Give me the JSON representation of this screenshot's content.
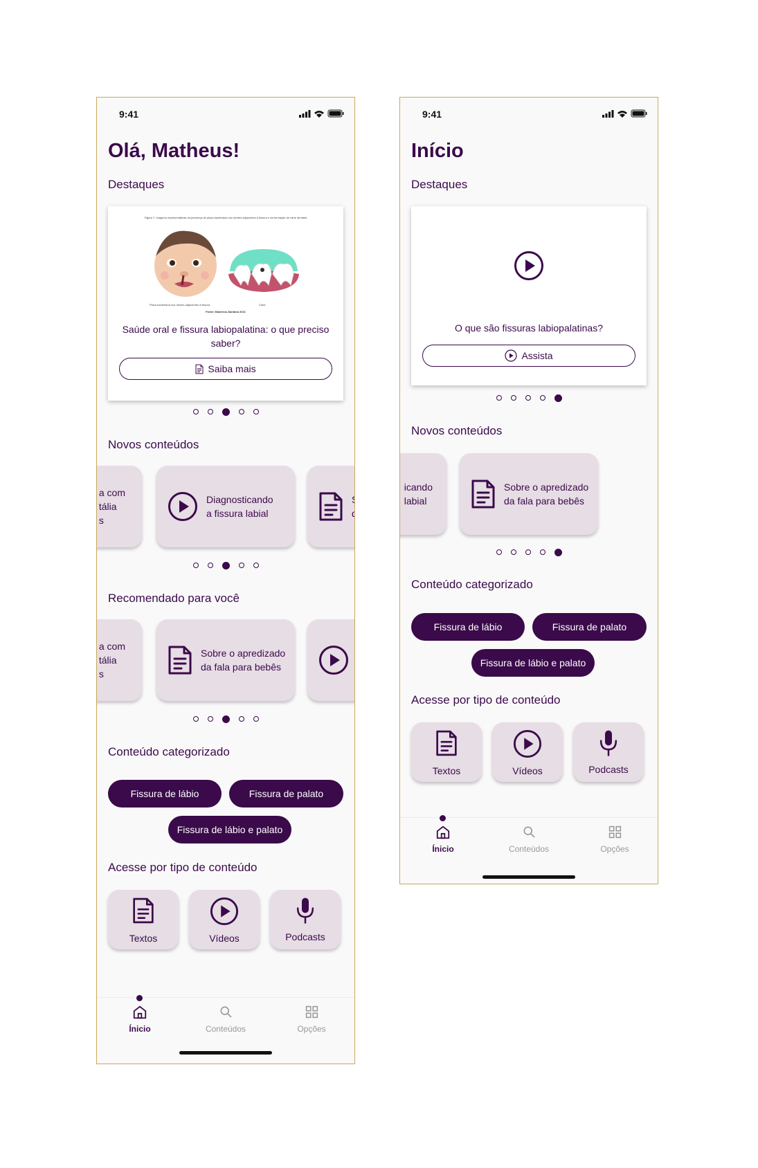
{
  "colors": {
    "primary": "#3a0a4a",
    "card_bg": "#e7dde5",
    "screen_bg": "#faf9fa",
    "frame_border": "#c9a85a"
  },
  "screen1": {
    "status_time": "9:41",
    "greeting": "Olá, Matheus!",
    "highlights": {
      "title": "Destaques",
      "figure_caption": "Figura 7: Imagens representativas da presença de placa bacteriana nos dentes adjacentes à fissura e da formação de cárie dentária",
      "figure_label_left": "Placa bacteriana nos dentes adjacentes à fissura",
      "figure_label_right": "Cárie",
      "figure_source": "Fonte: Madeiros-Santana 2021",
      "card_text": "Saúde oral e fissura labiopalatina: o que preciso saber?",
      "button_label": "Saiba mais",
      "dots_total": 5,
      "dots_active": 3
    },
    "new_content": {
      "title": "Novos conteúdos",
      "cards": [
        {
          "line1": "a com",
          "line2": "tália",
          "line3": "s",
          "icon": "partial-card"
        },
        {
          "line1": "Diagnosticando",
          "line2": "a fissura labial",
          "icon": "play-circle-icon"
        },
        {
          "line1": "S",
          "line2": "d",
          "icon": "document-icon"
        }
      ],
      "dots_active": 3
    },
    "recommended": {
      "title": "Recomendado para você",
      "cards": [
        {
          "line1": "a com",
          "line2": "tália",
          "line3": "s"
        },
        {
          "line1": "Sobre o apredizado",
          "line2": "da fala para bebês",
          "icon": "document-icon"
        },
        {
          "icon": "play-circle-icon"
        }
      ],
      "dots_active": 3
    },
    "categorized": {
      "title": "Conteúdo categorizado",
      "pills": [
        "Fissura de lábio",
        "Fissura de palato",
        "Fissura de lábio e palato"
      ]
    },
    "by_type": {
      "title": "Acesse por tipo de conteúdo",
      "items": [
        {
          "label": "Textos",
          "icon": "document-icon"
        },
        {
          "label": "Vídeos",
          "icon": "play-circle-icon"
        },
        {
          "label": "Podcasts",
          "icon": "microphone-icon"
        }
      ]
    },
    "tabs": [
      {
        "label": "Ínicio",
        "icon": "home-icon",
        "active": true
      },
      {
        "label": "Conteúdos",
        "icon": "search-icon",
        "active": false
      },
      {
        "label": "Opções",
        "icon": "grid-icon",
        "active": false
      }
    ]
  },
  "screen2": {
    "status_time": "9:41",
    "title": "Início",
    "highlights": {
      "title": "Destaques",
      "card_text": "O que são fissuras labiopalatinas?",
      "button_label": "Assista",
      "dots_active": 5
    },
    "new_content": {
      "title": "Novos conteúdos",
      "cards": [
        {
          "line1": "icando",
          "line2": "labial"
        },
        {
          "line1": "Sobre o apredizado",
          "line2": "da fala para bebês",
          "icon": "document-icon"
        }
      ],
      "dots_active": 5
    },
    "categorized": {
      "title": "Conteúdo categorizado",
      "pills": [
        "Fissura de lábio",
        "Fissura de palato",
        "Fissura de lábio e palato"
      ]
    },
    "by_type": {
      "title": "Acesse por tipo de conteúdo",
      "items": [
        {
          "label": "Textos",
          "icon": "document-icon"
        },
        {
          "label": "Vídeos",
          "icon": "play-circle-icon"
        },
        {
          "label": "Podcasts",
          "icon": "microphone-icon"
        }
      ]
    },
    "tabs": [
      {
        "label": "Ínicio",
        "icon": "home-icon",
        "active": true
      },
      {
        "label": "Conteúdos",
        "icon": "search-icon",
        "active": false
      },
      {
        "label": "Opções",
        "icon": "grid-icon",
        "active": false
      }
    ]
  }
}
